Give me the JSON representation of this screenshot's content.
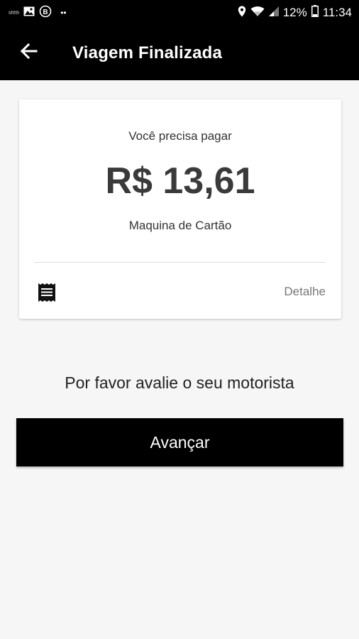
{
  "status_bar": {
    "left_tiny_text": "shhh",
    "dots": "••",
    "battery_percent": "12%",
    "time": "11:34",
    "icons": [
      "image-icon",
      "b-badge-icon",
      "location-icon",
      "wifi-icon",
      "signal-icon",
      "battery-icon"
    ]
  },
  "app_bar": {
    "title": "Viagem Finalizada",
    "back_icon": "arrow-left-icon"
  },
  "card": {
    "pay_label": "Você precisa pagar",
    "amount": "R$ 13,61",
    "payment_method": "Maquina de Cartão",
    "receipt_icon": "receipt-icon",
    "detail_link": "Detalhe"
  },
  "rating": {
    "prompt": "Por favor avalie o seu motorista"
  },
  "actions": {
    "next_label": "Avançar"
  },
  "colors": {
    "bar_background": "#000000",
    "page_background": "#f7f6f7",
    "card_background": "#ffffff",
    "amount_text": "#3a3a3a",
    "link_text": "#777777"
  }
}
